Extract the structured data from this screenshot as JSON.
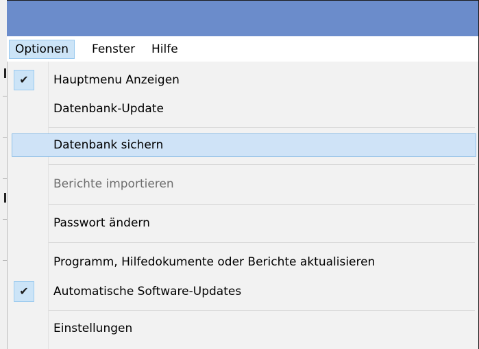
{
  "menubar": {
    "items": [
      {
        "label": "Optionen",
        "active": true
      },
      {
        "label": "Fenster",
        "active": false
      },
      {
        "label": "Hilfe",
        "active": false
      }
    ]
  },
  "menu": {
    "check_glyph": "✔",
    "items": [
      {
        "label": "Hauptmenu Anzeigen",
        "checked": true,
        "enabled": true
      },
      {
        "label": "Datenbank-Update",
        "checked": false,
        "enabled": true
      },
      {
        "label": "Datenbank sichern",
        "checked": false,
        "enabled": true,
        "highlighted": true
      },
      {
        "label": "Berichte importieren",
        "checked": false,
        "enabled": false
      },
      {
        "label": "Passwort ändern",
        "checked": false,
        "enabled": true
      },
      {
        "label": "Programm, Hilfedokumente oder Berichte aktualisieren",
        "checked": false,
        "enabled": true
      },
      {
        "label": "Automatische Software-Updates",
        "checked": true,
        "enabled": true
      },
      {
        "label": "Einstellungen",
        "checked": false,
        "enabled": true
      }
    ]
  },
  "colors": {
    "titlebar": "#6b8ccb",
    "highlight": "#cfe3f7",
    "highlight_border": "#8fbfe8",
    "disabled_text": "#6d6d6d"
  }
}
